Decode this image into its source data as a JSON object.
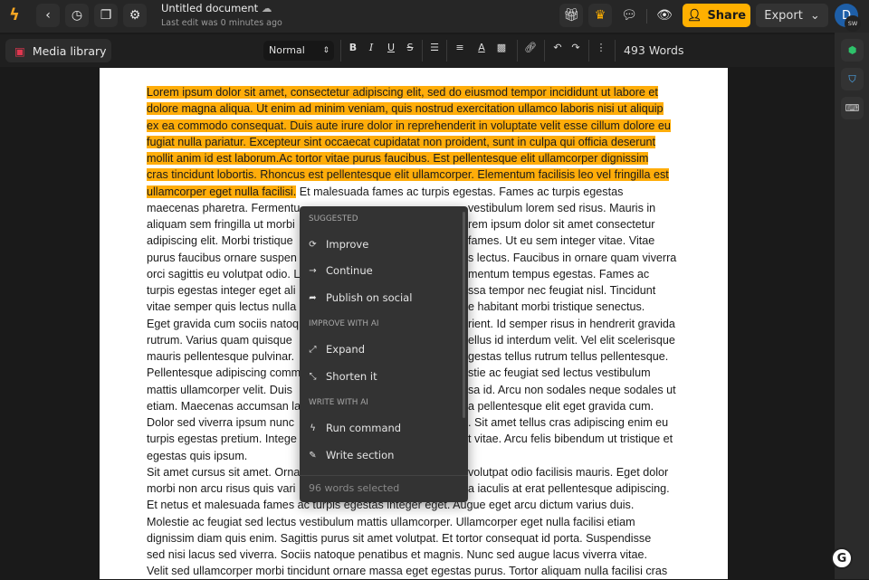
{
  "header": {
    "title": "Untitled document",
    "subtitle": "Last edit was 0 minutes ago",
    "share": "Share",
    "export": "Export",
    "avatar_initial": "D",
    "avatar_badge": "SW"
  },
  "toolbar": {
    "media_library": "Media library",
    "style": "Normal",
    "bold": "B",
    "italic": "I",
    "underline": "U",
    "strike": "S",
    "word_count": "493 Words"
  },
  "colors": {
    "accent": "#ffb000",
    "highlight": "#ffad0a",
    "menu_bg": "#333333"
  },
  "menu": {
    "h1": "SUGGESTED",
    "improve": "Improve",
    "continue": "Continue",
    "publish": "Publish on social",
    "h2": "IMPROVE WITH AI",
    "expand": "Expand",
    "shorten": "Shorten it",
    "h3": "WRITE WITH AI",
    "run": "Run command",
    "write": "Write section",
    "footer": "96 words selected"
  },
  "lines": [
    {
      "hl": "Lorem ipsum dolor sit amet, consectetur adipiscing elit, sed do eiusmod tempor incididunt ut labore et"
    },
    {
      "hl": "dolore magna aliqua. Ut enim ad minim veniam, quis nostrud exercitation ullamco laboris nisi ut aliquip"
    },
    {
      "hl": "ex ea commodo consequat. Duis aute irure dolor in reprehenderit in voluptate velit esse cillum dolore eu"
    },
    {
      "hl": "fugiat nulla pariatur. Excepteur sint occaecat cupidatat non proident, sunt in culpa qui officia deserunt"
    },
    {
      "hl": "mollit anim id est laborum.Ac tortor vitae purus faucibus. Est pellentesque elit ullamcorper dignissim"
    },
    {
      "hl": "cras tincidunt lobortis. Rhoncus est pellentesque elit ullamcorper. Elementum facilisis leo vel fringilla est"
    },
    {
      "hl": "ullamcorper eget nulla facilisi.",
      "l": " Et malesuada fames ac turpis egestas. Fames ac turpis egestas"
    },
    {
      "l": "maecenas pharetra. Fermentu",
      "r": "vestibulum lorem sed risus. Mauris in"
    },
    {
      "l": "aliquam sem fringilla ut morbi",
      "r": "rem ipsum dolor sit amet consectetur"
    },
    {
      "l": "adipiscing elit. Morbi tristique",
      "r": "fames. Ut eu sem integer vitae. Vitae"
    },
    {
      "l": "purus faucibus ornare suspen",
      "r": "s lectus. Faucibus in ornare quam viverra"
    },
    {
      "l": "orci sagittis eu volutpat odio. L",
      "r": "mentum tempus egestas. Fames ac"
    },
    {
      "l": "turpis egestas integer eget ali",
      "r": "ssa tempor nec feugiat nisl. Tincidunt"
    },
    {
      "l": "vitae semper quis lectus nulla",
      "r": "e habitant morbi tristique senectus."
    },
    {
      "l": "Eget gravida cum sociis natoq",
      "r": "rient. Id semper risus in hendrerit gravida"
    },
    {
      "l": "rutrum. Varius quam quisque",
      "r": "ellus id interdum velit. Vel elit scelerisque"
    },
    {
      "l": "mauris pellentesque pulvinar.",
      "r": "gestas tellus rutrum tellus pellentesque."
    },
    {
      "l": "Pellentesque adipiscing comm",
      "r": "stie ac feugiat sed lectus vestibulum"
    },
    {
      "l": "mattis ullamcorper velit. Duis",
      "r": "sa id. Arcu non sodales neque sodales ut"
    },
    {
      "l": "etiam. Maecenas accumsan la",
      "r": "a pellentesque elit eget gravida cum."
    },
    {
      "l": "Dolor sed viverra ipsum nunc",
      "r": ". Sit amet tellus cras adipiscing enim eu"
    },
    {
      "l": "turpis egestas pretium. Intege",
      "r": "t vitae. Arcu felis bibendum ut tristique et"
    },
    {
      "l": "egestas quis ipsum."
    },
    {
      "l": "Sit amet cursus sit amet. Orna",
      "r": "volutpat odio facilisis mauris. Eget dolor"
    },
    {
      "l": "morbi non arcu risus quis vari",
      "r": "a iaculis at erat pellentesque adipiscing."
    },
    {
      "l": "Et netus et malesuada fames ac turpis egestas integer eget. Augue eget arcu dictum varius duis."
    },
    {
      "l": "Molestie ac feugiat sed lectus vestibulum mattis ullamcorper. Ullamcorper eget nulla facilisi etiam"
    },
    {
      "l": "dignissim diam quis enim. Sagittis purus sit amet volutpat. Et tortor consequat id porta. Suspendisse"
    },
    {
      "l": "sed nisi lacus sed viverra. Sociis natoque penatibus et magnis. Nunc sed augue lacus viverra vitae."
    },
    {
      "l": "Velit sed ullamcorper morbi tincidunt ornare massa eget egestas purus. Tortor aliquam nulla facilisi cras"
    }
  ]
}
